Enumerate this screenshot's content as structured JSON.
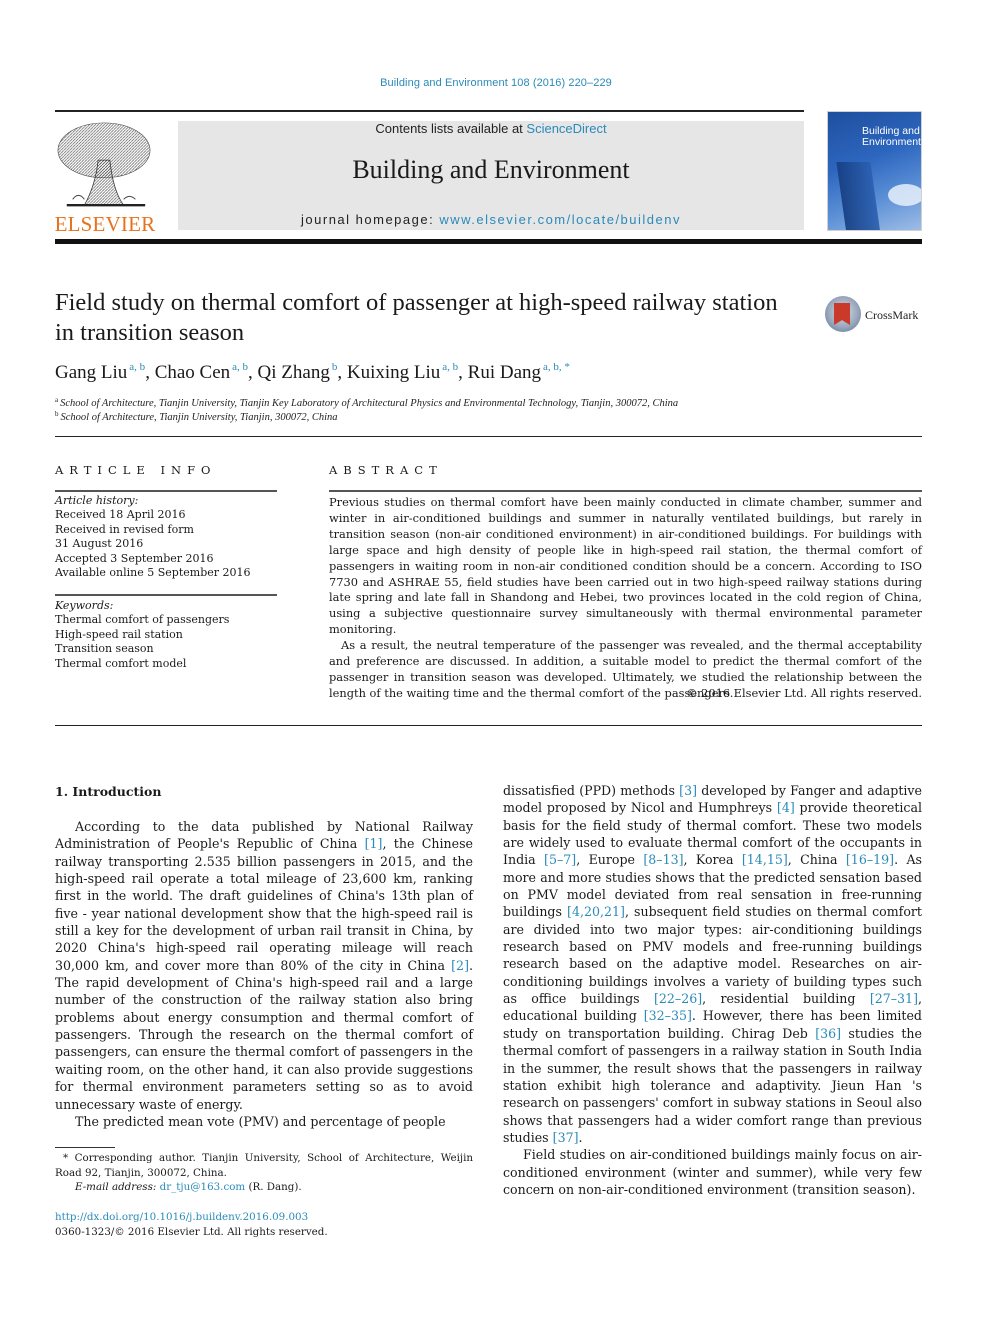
{
  "header": {
    "citation": "Building and Environment 108 (2016) 220–229",
    "contents_prefix": "Contents lists available at ",
    "contents_link": "ScienceDirect",
    "journal_name": "Building and Environment",
    "homepage_prefix": "journal homepage: ",
    "homepage_link": "www.elsevier.com/locate/buildenv",
    "publisher_logo_text": "ELSEVIER",
    "cover_title_line1": "Building and",
    "cover_title_line2": "Environment",
    "crossmark_label": "CrossMark",
    "colors": {
      "link": "#2a8ab8",
      "elsevier_orange": "#e9711c",
      "banner_bg": "#e6e6e6"
    }
  },
  "article": {
    "title": "Field study on thermal comfort of passenger at high-speed railway station in transition season",
    "authors": [
      {
        "name": "Gang Liu",
        "affil": "a, b"
      },
      {
        "name": "Chao Cen",
        "affil": "a, b"
      },
      {
        "name": "Qi Zhang",
        "affil": "b"
      },
      {
        "name": "Kuixing Liu",
        "affil": "a, b"
      },
      {
        "name": "Rui Dang",
        "affil": "a, b, *"
      }
    ],
    "affiliations": [
      {
        "key": "a",
        "text": "School of Architecture, Tianjin University, Tianjin Key Laboratory of Architectural Physics and Environmental Technology, Tianjin, 300072, China"
      },
      {
        "key": "b",
        "text": "School of Architecture, Tianjin University, Tianjin, 300072, China"
      }
    ]
  },
  "article_info": {
    "heading": "ARTICLE INFO",
    "history_label": "Article history:",
    "history": [
      "Received 18 April 2016",
      "Received in revised form",
      "31 August 2016",
      "Accepted 3 September 2016",
      "Available online 5 September 2016"
    ],
    "keywords_label": "Keywords:",
    "keywords": [
      "Thermal comfort of passengers",
      "High-speed rail station",
      "Transition season",
      "Thermal comfort model"
    ]
  },
  "abstract": {
    "heading": "ABSTRACT",
    "paragraphs": [
      "Previous studies on thermal comfort have been mainly conducted in climate chamber, summer and winter in air-conditioned buildings and summer in naturally ventilated buildings, but rarely in transition season (non-air conditioned environment) in air-conditioned buildings. For buildings with large space and high density of people like in high-speed rail station, the thermal comfort of passengers in waiting room in non-air conditioned condition should be a concern. According to ISO 7730 and ASHRAE 55, field studies have been carried out in two high-speed railway stations during late spring and late fall in Shandong and Hebei, two provinces located in the cold region of China, using a subjective questionnaire survey simultaneously with thermal environmental parameter monitoring.",
      "As a result, the neutral temperature of the passenger was revealed, and the thermal acceptability and preference are discussed. In addition, a suitable model to predict the thermal comfort of the passenger in transition season was developed. Ultimately, we studied the relationship between the length of the waiting time and the thermal comfort of the passengers."
    ],
    "copyright": "© 2016 Elsevier Ltd. All rights reserved."
  },
  "body": {
    "section_heading": "1.  Introduction",
    "left_p1": [
      {
        "t": "According to the data published by National Railway Administration of People's Republic of China "
      },
      {
        "ref": "[1]"
      },
      {
        "t": ", the Chinese railway transporting 2.535 billion passengers in 2015, and the high-speed rail operate a total mileage of 23,600 km, ranking first in the world. The draft guidelines of China's 13th plan of five - year national development show that the high-speed rail is still a key for the development of urban rail transit in China, by 2020 China's high-speed rail operating mileage will reach 30,000 km, and cover more than 80% of the city in China "
      },
      {
        "ref": "[2]"
      },
      {
        "t": ". The rapid development of China's high-speed rail and a large number of the construction of the railway station also bring problems about energy consumption and thermal comfort of passengers. Through the research on the thermal comfort of passengers, can ensure the thermal comfort of passengers in the waiting room, on the other hand, it can also provide suggestions for thermal environment parameters setting so as to avoid unnecessary waste of energy."
      }
    ],
    "left_p2": "The predicted mean vote (PMV) and percentage of people",
    "right_p1": [
      {
        "t": "dissatisfied (PPD) methods "
      },
      {
        "ref": "[3]"
      },
      {
        "t": " developed by Fanger and adaptive model proposed by Nicol and Humphreys "
      },
      {
        "ref": "[4]"
      },
      {
        "t": " provide theoretical basis for the field study of thermal comfort. These two models are widely used to evaluate thermal comfort of the occupants in India "
      },
      {
        "ref": "[5–7]"
      },
      {
        "t": ", Europe "
      },
      {
        "ref": "[8–13]"
      },
      {
        "t": ", Korea "
      },
      {
        "ref": "[14,15]"
      },
      {
        "t": ", China "
      },
      {
        "ref": "[16–19]"
      },
      {
        "t": ". As more and more studies shows that the predicted sensation based on PMV model deviated from real sensation in free-running buildings "
      },
      {
        "ref": "[4,20,21]"
      },
      {
        "t": ", subsequent field studies on thermal comfort are divided into two major types: air-conditioning buildings research based on PMV models and free-running buildings research based on the adaptive model. Researches on air-conditioning buildings involves a variety of building types such as office buildings "
      },
      {
        "ref": "[22–26]"
      },
      {
        "t": ", residential building "
      },
      {
        "ref": "[27–31]"
      },
      {
        "t": ", educational building "
      },
      {
        "ref": "[32–35]"
      },
      {
        "t": ". However, there has been limited study on transportation building. Chirag Deb "
      },
      {
        "ref": "[36]"
      },
      {
        "t": " studies the thermal comfort of passengers in a railway station in South India in the summer, the result shows that the passengers in railway station exhibit high tolerance and adaptivity. Jieun Han 's research on passengers' comfort in subway stations in Seoul also shows that passengers had a wider comfort range than previous studies "
      },
      {
        "ref": "[37]"
      },
      {
        "t": "."
      }
    ],
    "right_p2": "Field studies on air-conditioned buildings mainly focus on air-conditioned environment (winter and summer), while very few concern on non-air-conditioned environment (transition season)."
  },
  "footnote": {
    "marker": "*",
    "corresponding": "Corresponding author. Tianjin University, School of Architecture, Weijin Road 92, Tianjin, 300072, China.",
    "email_label": "E-mail address: ",
    "email": "dr_tju@163.com",
    "email_suffix": " (R. Dang).",
    "doi": "http://dx.doi.org/10.1016/j.buildenv.2016.09.003",
    "issn_line": "0360-1323/© 2016 Elsevier Ltd. All rights reserved."
  }
}
